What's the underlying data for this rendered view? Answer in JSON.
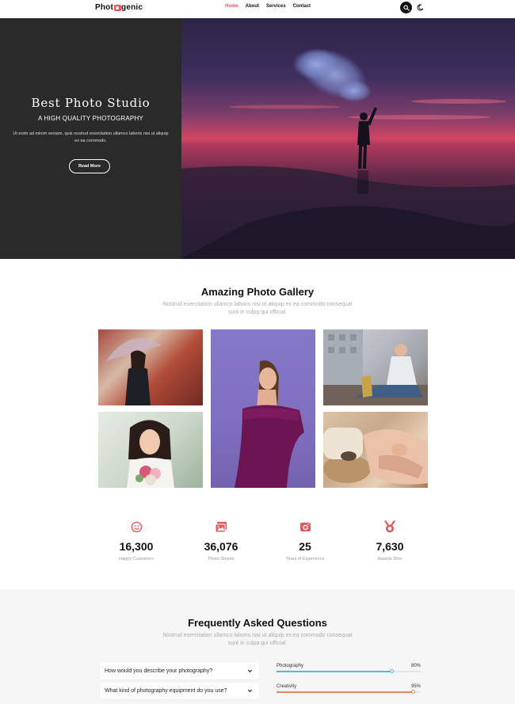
{
  "header": {
    "logo_prefix": "Phot",
    "logo_suffix": "genic",
    "nav": [
      {
        "label": "Home",
        "active": true
      },
      {
        "label": "About",
        "active": false
      },
      {
        "label": "Services",
        "active": false
      },
      {
        "label": "Contact",
        "active": false
      }
    ],
    "search_icon": "search-icon",
    "theme_icon": "moon-icon"
  },
  "hero": {
    "title": "Best Photo Studio",
    "subtitle": "A HIGH QUALITY PHOTOGRAPHY",
    "text": "Ut enim ad minim veniam, quis nostrud exercitation ullamco laboris nisi ut aliquip ex ea commodo.",
    "button": "Read More"
  },
  "gallery": {
    "title": "Amazing Photo Gallery",
    "description": "Nostrud exercitation ullamco laboris nisi ut aliquip ex ea commodo consequat sunt in culpa qui official."
  },
  "stats": [
    {
      "value": "16,300",
      "label": "Happy Customers",
      "icon": "smile-icon"
    },
    {
      "value": "36,076",
      "label": "Photo Shoots",
      "icon": "photos-icon"
    },
    {
      "value": "25",
      "label": "Years of Experience",
      "icon": "camera-icon"
    },
    {
      "value": "7,630",
      "label": "Awards Won",
      "icon": "medal-icon"
    }
  ],
  "faq": {
    "title": "Frequently Asked Questions",
    "description": "Nostrud exercitation ullamco laboris nisi ut aliquip ex ea commodo consequat sunt in culpa qui official.",
    "questions": [
      "How would you describe your photography?",
      "What kind of photography equipment do you use?"
    ],
    "skills": [
      {
        "name": "Photography",
        "value": "80%",
        "fraction": 0.8
      },
      {
        "name": "Creativity",
        "value": "95%",
        "fraction": 0.95
      }
    ]
  },
  "colors": {
    "accent": "#e8555d",
    "dark_panel": "#2a2a2a",
    "skill_photography": "#3cc8c8",
    "skill_creativity": "#e8855d"
  }
}
